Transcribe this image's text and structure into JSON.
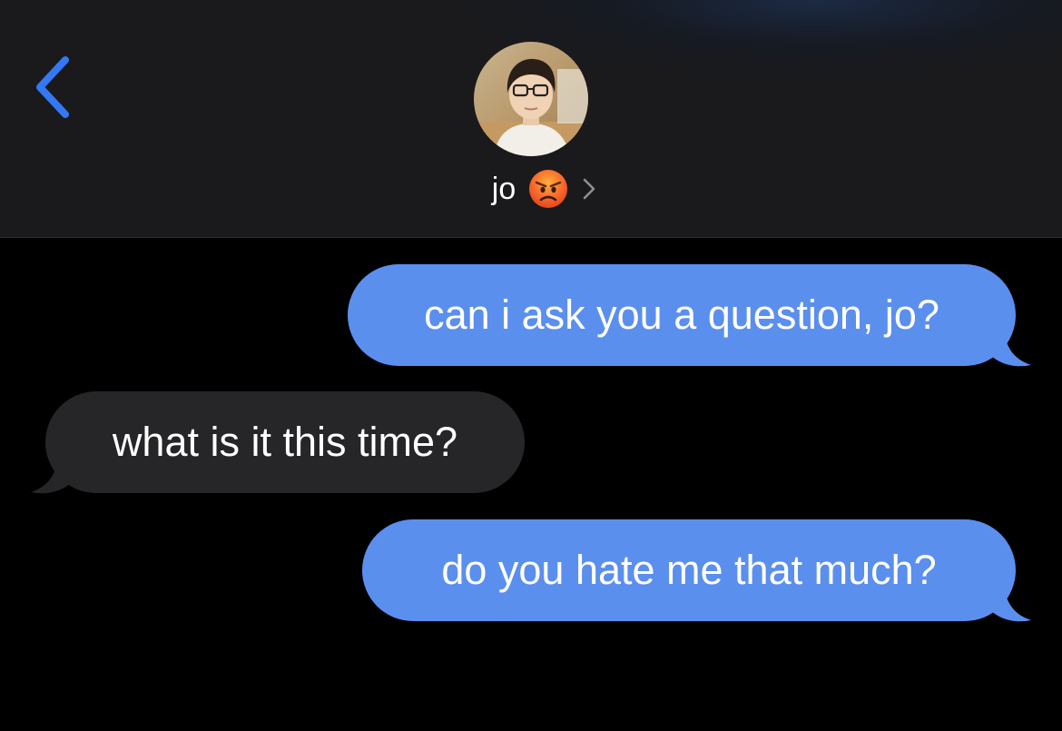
{
  "header": {
    "contact_name": "jo",
    "contact_emoji": "angry-face",
    "back_icon": "chevron-left-icon",
    "detail_icon": "chevron-right-icon",
    "accent_color": "#3478f6"
  },
  "messages": [
    {
      "direction": "sent",
      "text": "can i ask you a question, jo?"
    },
    {
      "direction": "received",
      "text": "what is it this time?"
    },
    {
      "direction": "sent",
      "text": "do you hate me that much?"
    }
  ],
  "colors": {
    "sent_bubble": "#5b8fee",
    "received_bubble": "#262628",
    "background": "#000000"
  }
}
